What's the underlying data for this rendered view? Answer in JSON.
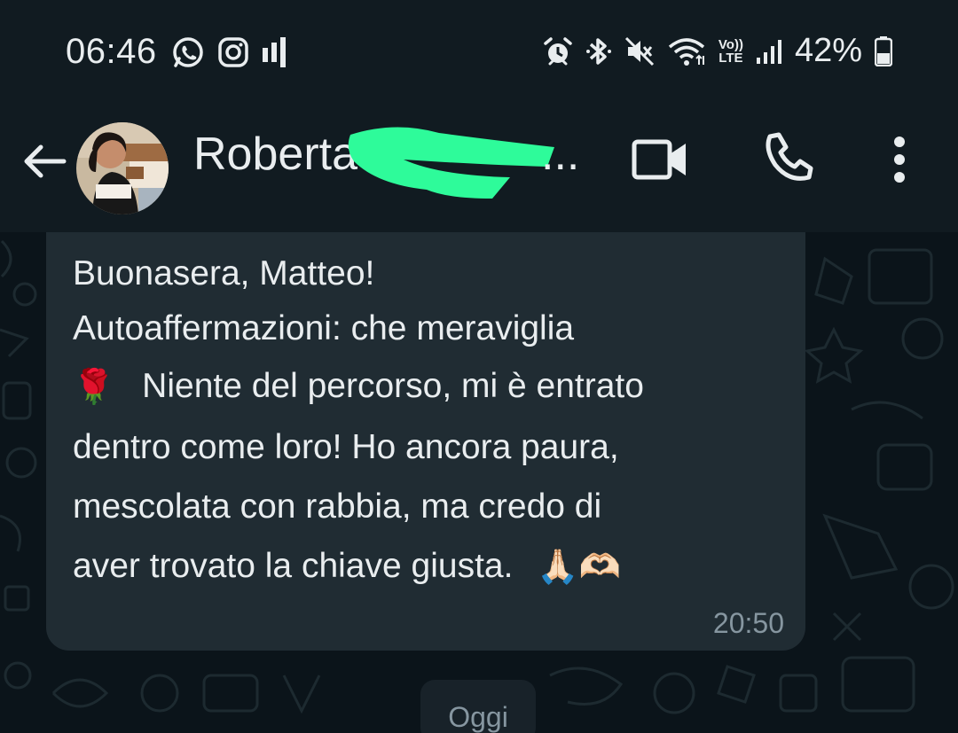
{
  "status_bar": {
    "time": "06:46",
    "battery_percent": "42%",
    "left_icons": [
      "whatsapp-icon",
      "instagram-icon",
      "signal-bars-icon"
    ],
    "right_icons": [
      "alarm-icon",
      "bluetooth-icon",
      "mute-icon",
      "wifi-icon",
      "volte-icon",
      "cell-signal-icon",
      "battery-icon"
    ],
    "volte_label_top": "Vo))",
    "volte_label_bottom": "LTE"
  },
  "header": {
    "contact_name": "Roberta",
    "ellipsis": "...",
    "icons": [
      "back-arrow-icon",
      "video-call-icon",
      "phone-icon",
      "more-options-icon"
    ]
  },
  "chat": {
    "message": {
      "line1": "Buonasera, Matteo!",
      "line2": "Autoaffermazioni: che meraviglia",
      "line3_emoji": "🌹",
      "line3": "Niente del percorso, mi è entrato",
      "line4": "dentro come loro! Ho ancora paura,",
      "line5": "mescolata con rabbia, ma credo di",
      "line6": "aver trovato la chiave giusta.",
      "line6_emojis": "🙏🏻🫶🏻",
      "time": "20:50"
    },
    "date_separator": "Oggi"
  },
  "colors": {
    "background": "#0b141a",
    "header": "#111b21",
    "bubble": "#202c33",
    "text": "#e9edef",
    "meta": "#8696a0",
    "redaction": "#2efb9a"
  }
}
